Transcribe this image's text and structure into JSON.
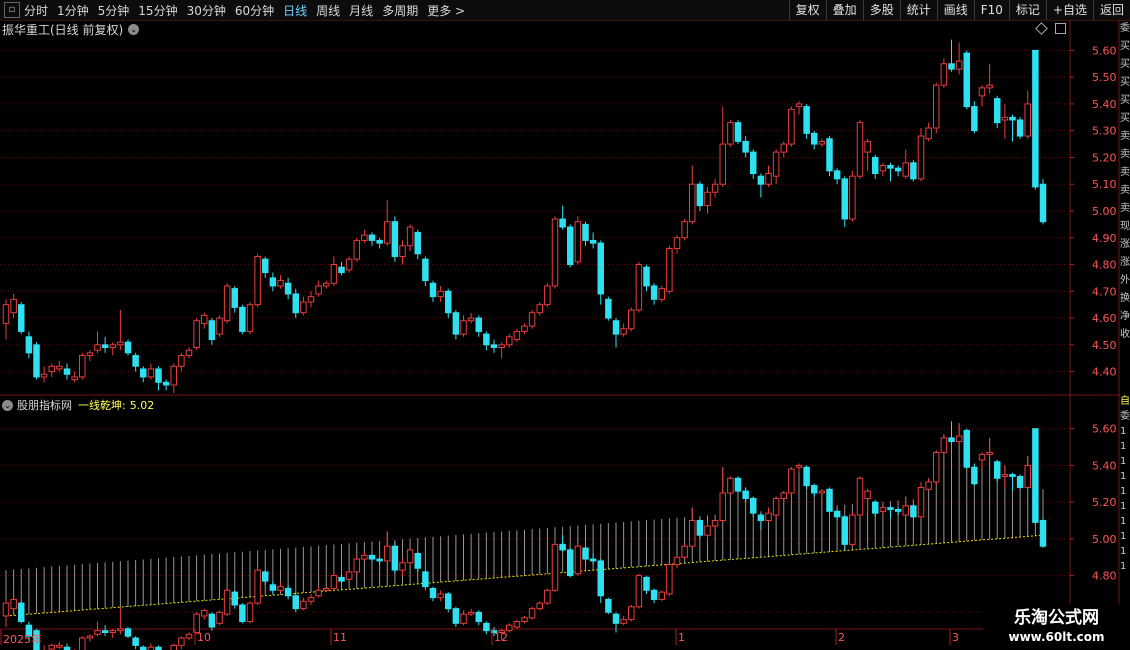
{
  "toolbar": {
    "periods": [
      "分时",
      "1分钟",
      "5分钟",
      "15分钟",
      "30分钟",
      "60分钟",
      "日线",
      "周线",
      "月线",
      "多周期",
      "更多 >"
    ],
    "active_period": "日线",
    "right_buttons": [
      "复权",
      "叠加",
      "多股",
      "统计",
      "画线",
      "F10",
      "标记",
      "+自选",
      "返回"
    ]
  },
  "main_chart": {
    "stock_title": "振华重工(日线 前复权)",
    "y_ticks": [
      "5.60",
      "5.50",
      "5.40",
      "5.30",
      "5.20",
      "5.10",
      "5.00",
      "4.90",
      "4.80",
      "4.70",
      "4.60",
      "4.50",
      "4.40"
    ]
  },
  "indicator": {
    "name": "股朋指标网",
    "line_name": "一线乾坤:",
    "line_value": "5.02",
    "y_ticks": [
      "5.60",
      "5.40",
      "5.20",
      "5.00",
      "4.80",
      "4.60"
    ]
  },
  "x_axis": {
    "labels": [
      "2025年",
      "10",
      "11",
      "12",
      "1",
      "2",
      "3"
    ]
  },
  "side_strip": {
    "top_chars": [
      "委",
      "买",
      "买",
      "买",
      "买",
      "买",
      "卖",
      "卖",
      "卖",
      "卖",
      "卖",
      "现",
      "涨",
      "涨",
      "外",
      "换",
      "净",
      "收"
    ],
    "bottom_chars": [
      "自",
      "委",
      "1",
      "1",
      "1",
      "1",
      "1",
      "1",
      "1",
      "1",
      "1",
      "1"
    ]
  },
  "watermark": {
    "line1": "乐淘公式网",
    "line2": "www.60lt.com"
  },
  "colors": {
    "up": "#e83d3d",
    "down": "#2ee0f0",
    "support_line": "#e8e800",
    "grid": "#5a0c0c",
    "axis_text": "#ff5555"
  },
  "chart_data": {
    "type": "candlestick",
    "ylim_main": [
      4.32,
      5.65
    ],
    "ylim_indicator": [
      4.52,
      5.68
    ],
    "x_labels": [
      "2025年",
      "10",
      "11",
      "12",
      "1",
      "2",
      "3"
    ],
    "support_line_last": 5.02,
    "candles": [
      {
        "o": 4.58,
        "c": 4.65,
        "h": 4.67,
        "l": 4.52
      },
      {
        "o": 4.62,
        "c": 4.67,
        "h": 4.69,
        "l": 4.6
      },
      {
        "o": 4.65,
        "c": 4.55,
        "h": 4.66,
        "l": 4.54
      },
      {
        "o": 4.53,
        "c": 4.47,
        "h": 4.55,
        "l": 4.45
      },
      {
        "o": 4.5,
        "c": 4.38,
        "h": 4.51,
        "l": 4.37
      },
      {
        "o": 4.38,
        "c": 4.39,
        "h": 4.42,
        "l": 4.36
      },
      {
        "o": 4.4,
        "c": 4.42,
        "h": 4.43,
        "l": 4.38
      },
      {
        "o": 4.41,
        "c": 4.42,
        "h": 4.44,
        "l": 4.4
      },
      {
        "o": 4.41,
        "c": 4.39,
        "h": 4.43,
        "l": 4.37
      },
      {
        "o": 4.37,
        "c": 4.38,
        "h": 4.4,
        "l": 4.36
      },
      {
        "o": 4.38,
        "c": 4.46,
        "h": 4.47,
        "l": 4.37
      },
      {
        "o": 4.46,
        "c": 4.47,
        "h": 4.48,
        "l": 4.44
      },
      {
        "o": 4.48,
        "c": 4.5,
        "h": 4.55,
        "l": 4.47
      },
      {
        "o": 4.5,
        "c": 4.49,
        "h": 4.53,
        "l": 4.47
      },
      {
        "o": 4.49,
        "c": 4.5,
        "h": 4.51,
        "l": 4.46
      },
      {
        "o": 4.5,
        "c": 4.51,
        "h": 4.63,
        "l": 4.48
      },
      {
        "o": 4.51,
        "c": 4.47,
        "h": 4.52,
        "l": 4.46
      },
      {
        "o": 4.46,
        "c": 4.42,
        "h": 4.47,
        "l": 4.4
      },
      {
        "o": 4.41,
        "c": 4.38,
        "h": 4.42,
        "l": 4.36
      },
      {
        "o": 4.38,
        "c": 4.41,
        "h": 4.43,
        "l": 4.37
      },
      {
        "o": 4.41,
        "c": 4.36,
        "h": 4.42,
        "l": 4.33
      },
      {
        "o": 4.36,
        "c": 4.35,
        "h": 4.37,
        "l": 4.33
      },
      {
        "o": 4.35,
        "c": 4.42,
        "h": 4.43,
        "l": 4.32
      },
      {
        "o": 4.42,
        "c": 4.46,
        "h": 4.47,
        "l": 4.4
      },
      {
        "o": 4.46,
        "c": 4.48,
        "h": 4.49,
        "l": 4.45
      },
      {
        "o": 4.49,
        "c": 4.59,
        "h": 4.6,
        "l": 4.48
      },
      {
        "o": 4.58,
        "c": 4.61,
        "h": 4.62,
        "l": 4.56
      },
      {
        "o": 4.59,
        "c": 4.52,
        "h": 4.6,
        "l": 4.5
      },
      {
        "o": 4.54,
        "c": 4.6,
        "h": 4.61,
        "l": 4.53
      },
      {
        "o": 4.59,
        "c": 4.72,
        "h": 4.73,
        "l": 4.58
      },
      {
        "o": 4.71,
        "c": 4.64,
        "h": 4.72,
        "l": 4.62
      },
      {
        "o": 4.64,
        "c": 4.55,
        "h": 4.65,
        "l": 4.54
      },
      {
        "o": 4.55,
        "c": 4.65,
        "h": 4.66,
        "l": 4.54
      },
      {
        "o": 4.65,
        "c": 4.83,
        "h": 4.84,
        "l": 4.64
      },
      {
        "o": 4.82,
        "c": 4.77,
        "h": 4.83,
        "l": 4.75
      },
      {
        "o": 4.75,
        "c": 4.72,
        "h": 4.77,
        "l": 4.7
      },
      {
        "o": 4.72,
        "c": 4.74,
        "h": 4.76,
        "l": 4.71
      },
      {
        "o": 4.73,
        "c": 4.69,
        "h": 4.75,
        "l": 4.67
      },
      {
        "o": 4.69,
        "c": 4.62,
        "h": 4.71,
        "l": 4.6
      },
      {
        "o": 4.62,
        "c": 4.66,
        "h": 4.68,
        "l": 4.61
      },
      {
        "o": 4.66,
        "c": 4.68,
        "h": 4.7,
        "l": 4.64
      },
      {
        "o": 4.69,
        "c": 4.72,
        "h": 4.74,
        "l": 4.68
      },
      {
        "o": 4.72,
        "c": 4.73,
        "h": 4.74,
        "l": 4.71
      },
      {
        "o": 4.73,
        "c": 4.8,
        "h": 4.83,
        "l": 4.72
      },
      {
        "o": 4.79,
        "c": 4.77,
        "h": 4.81,
        "l": 4.76
      },
      {
        "o": 4.78,
        "c": 4.82,
        "h": 4.83,
        "l": 4.77
      },
      {
        "o": 4.82,
        "c": 4.89,
        "h": 4.9,
        "l": 4.81
      },
      {
        "o": 4.89,
        "c": 4.91,
        "h": 4.93,
        "l": 4.88
      },
      {
        "o": 4.91,
        "c": 4.89,
        "h": 4.92,
        "l": 4.87
      },
      {
        "o": 4.89,
        "c": 4.88,
        "h": 4.9,
        "l": 4.86
      },
      {
        "o": 4.88,
        "c": 4.96,
        "h": 5.04,
        "l": 4.87
      },
      {
        "o": 4.96,
        "c": 4.83,
        "h": 4.98,
        "l": 4.81
      },
      {
        "o": 4.83,
        "c": 4.87,
        "h": 4.89,
        "l": 4.8
      },
      {
        "o": 4.87,
        "c": 4.94,
        "h": 4.95,
        "l": 4.85
      },
      {
        "o": 4.92,
        "c": 4.84,
        "h": 4.93,
        "l": 4.82
      },
      {
        "o": 4.82,
        "c": 4.74,
        "h": 4.83,
        "l": 4.72
      },
      {
        "o": 4.73,
        "c": 4.68,
        "h": 4.74,
        "l": 4.66
      },
      {
        "o": 4.68,
        "c": 4.7,
        "h": 4.72,
        "l": 4.66
      },
      {
        "o": 4.7,
        "c": 4.62,
        "h": 4.71,
        "l": 4.6
      },
      {
        "o": 4.62,
        "c": 4.54,
        "h": 4.63,
        "l": 4.52
      },
      {
        "o": 4.54,
        "c": 4.59,
        "h": 4.61,
        "l": 4.53
      },
      {
        "o": 4.59,
        "c": 4.6,
        "h": 4.62,
        "l": 4.58
      },
      {
        "o": 4.6,
        "c": 4.55,
        "h": 4.61,
        "l": 4.53
      },
      {
        "o": 4.54,
        "c": 4.5,
        "h": 4.55,
        "l": 4.48
      },
      {
        "o": 4.5,
        "c": 4.49,
        "h": 4.52,
        "l": 4.47
      },
      {
        "o": 4.49,
        "c": 4.5,
        "h": 4.51,
        "l": 4.45
      },
      {
        "o": 4.5,
        "c": 4.53,
        "h": 4.54,
        "l": 4.49
      },
      {
        "o": 4.52,
        "c": 4.55,
        "h": 4.56,
        "l": 4.51
      },
      {
        "o": 4.55,
        "c": 4.57,
        "h": 4.58,
        "l": 4.54
      },
      {
        "o": 4.57,
        "c": 4.62,
        "h": 4.63,
        "l": 4.56
      },
      {
        "o": 4.62,
        "c": 4.65,
        "h": 4.66,
        "l": 4.61
      },
      {
        "o": 4.65,
        "c": 4.72,
        "h": 4.73,
        "l": 4.64
      },
      {
        "o": 4.72,
        "c": 4.97,
        "h": 4.98,
        "l": 4.71
      },
      {
        "o": 4.97,
        "c": 4.94,
        "h": 5.02,
        "l": 4.93
      },
      {
        "o": 4.94,
        "c": 4.8,
        "h": 4.95,
        "l": 4.79
      },
      {
        "o": 4.81,
        "c": 4.96,
        "h": 4.98,
        "l": 4.8
      },
      {
        "o": 4.95,
        "c": 4.89,
        "h": 4.96,
        "l": 4.87
      },
      {
        "o": 4.89,
        "c": 4.88,
        "h": 4.92,
        "l": 4.86
      },
      {
        "o": 4.88,
        "c": 4.69,
        "h": 4.89,
        "l": 4.65
      },
      {
        "o": 4.67,
        "c": 4.6,
        "h": 4.68,
        "l": 4.59
      },
      {
        "o": 4.59,
        "c": 4.54,
        "h": 4.6,
        "l": 4.49
      },
      {
        "o": 4.54,
        "c": 4.56,
        "h": 4.58,
        "l": 4.53
      },
      {
        "o": 4.56,
        "c": 4.63,
        "h": 4.64,
        "l": 4.55
      },
      {
        "o": 4.63,
        "c": 4.8,
        "h": 4.81,
        "l": 4.62
      },
      {
        "o": 4.79,
        "c": 4.72,
        "h": 4.8,
        "l": 4.7
      },
      {
        "o": 4.72,
        "c": 4.67,
        "h": 4.73,
        "l": 4.65
      },
      {
        "o": 4.67,
        "c": 4.71,
        "h": 4.72,
        "l": 4.66
      },
      {
        "o": 4.7,
        "c": 4.86,
        "h": 4.87,
        "l": 4.69
      },
      {
        "o": 4.86,
        "c": 4.9,
        "h": 4.91,
        "l": 4.84
      },
      {
        "o": 4.9,
        "c": 4.96,
        "h": 4.97,
        "l": 4.89
      },
      {
        "o": 4.96,
        "c": 5.1,
        "h": 5.17,
        "l": 4.95
      },
      {
        "o": 5.1,
        "c": 5.02,
        "h": 5.11,
        "l": 5.0
      },
      {
        "o": 5.02,
        "c": 5.07,
        "h": 5.09,
        "l": 4.99
      },
      {
        "o": 5.07,
        "c": 5.1,
        "h": 5.12,
        "l": 5.05
      },
      {
        "o": 5.1,
        "c": 5.25,
        "h": 5.39,
        "l": 5.09
      },
      {
        "o": 5.25,
        "c": 5.33,
        "h": 5.34,
        "l": 5.24
      },
      {
        "o": 5.33,
        "c": 5.26,
        "h": 5.34,
        "l": 5.25
      },
      {
        "o": 5.26,
        "c": 5.22,
        "h": 5.28,
        "l": 5.2
      },
      {
        "o": 5.22,
        "c": 5.14,
        "h": 5.23,
        "l": 5.12
      },
      {
        "o": 5.13,
        "c": 5.1,
        "h": 5.14,
        "l": 5.05
      },
      {
        "o": 5.1,
        "c": 5.14,
        "h": 5.17,
        "l": 5.09
      },
      {
        "o": 5.13,
        "c": 5.22,
        "h": 5.23,
        "l": 5.1
      },
      {
        "o": 5.22,
        "c": 5.25,
        "h": 5.26,
        "l": 5.2
      },
      {
        "o": 5.25,
        "c": 5.38,
        "h": 5.39,
        "l": 5.24
      },
      {
        "o": 5.39,
        "c": 5.4,
        "h": 5.41,
        "l": 5.36
      },
      {
        "o": 5.39,
        "c": 5.29,
        "h": 5.4,
        "l": 5.27
      },
      {
        "o": 5.29,
        "c": 5.25,
        "h": 5.3,
        "l": 5.23
      },
      {
        "o": 5.25,
        "c": 5.26,
        "h": 5.27,
        "l": 5.24
      },
      {
        "o": 5.27,
        "c": 5.15,
        "h": 5.28,
        "l": 5.13
      },
      {
        "o": 5.15,
        "c": 5.12,
        "h": 5.16,
        "l": 5.1
      },
      {
        "o": 5.12,
        "c": 4.97,
        "h": 5.13,
        "l": 4.94
      },
      {
        "o": 4.97,
        "c": 5.13,
        "h": 5.15,
        "l": 4.96
      },
      {
        "o": 5.13,
        "c": 5.33,
        "h": 5.34,
        "l": 5.12
      },
      {
        "o": 5.22,
        "c": 5.26,
        "h": 5.27,
        "l": 5.15
      },
      {
        "o": 5.2,
        "c": 5.14,
        "h": 5.21,
        "l": 5.12
      },
      {
        "o": 5.15,
        "c": 5.17,
        "h": 5.18,
        "l": 5.13
      },
      {
        "o": 5.17,
        "c": 5.16,
        "h": 5.18,
        "l": 5.11
      },
      {
        "o": 5.16,
        "c": 5.15,
        "h": 5.17,
        "l": 5.13
      },
      {
        "o": 5.13,
        "c": 5.18,
        "h": 5.23,
        "l": 5.12
      },
      {
        "o": 5.18,
        "c": 5.12,
        "h": 5.19,
        "l": 5.11
      },
      {
        "o": 5.12,
        "c": 5.28,
        "h": 5.31,
        "l": 5.11
      },
      {
        "o": 5.27,
        "c": 5.31,
        "h": 5.33,
        "l": 5.26
      },
      {
        "o": 5.31,
        "c": 5.47,
        "h": 5.48,
        "l": 5.29
      },
      {
        "o": 5.47,
        "c": 5.55,
        "h": 5.57,
        "l": 5.46
      },
      {
        "o": 5.55,
        "c": 5.53,
        "h": 5.64,
        "l": 5.52
      },
      {
        "o": 5.53,
        "c": 5.56,
        "h": 5.63,
        "l": 5.51
      },
      {
        "o": 5.59,
        "c": 5.39,
        "h": 5.6,
        "l": 5.38
      },
      {
        "o": 5.39,
        "c": 5.3,
        "h": 5.41,
        "l": 5.29
      },
      {
        "o": 5.43,
        "c": 5.46,
        "h": 5.47,
        "l": 5.39
      },
      {
        "o": 5.46,
        "c": 5.47,
        "h": 5.55,
        "l": 5.44
      },
      {
        "o": 5.42,
        "c": 5.33,
        "h": 5.43,
        "l": 5.31
      },
      {
        "o": 5.34,
        "c": 5.35,
        "h": 5.4,
        "l": 5.27
      },
      {
        "o": 5.35,
        "c": 5.34,
        "h": 5.36,
        "l": 5.26
      },
      {
        "o": 5.34,
        "c": 5.28,
        "h": 5.35,
        "l": 5.27
      },
      {
        "o": 5.28,
        "c": 5.4,
        "h": 5.45,
        "l": 5.27
      },
      {
        "o": 5.6,
        "c": 5.09,
        "h": 5.6,
        "l": 5.08
      },
      {
        "o": 5.1,
        "c": 4.96,
        "h": 5.12,
        "l": 4.95
      }
    ]
  }
}
